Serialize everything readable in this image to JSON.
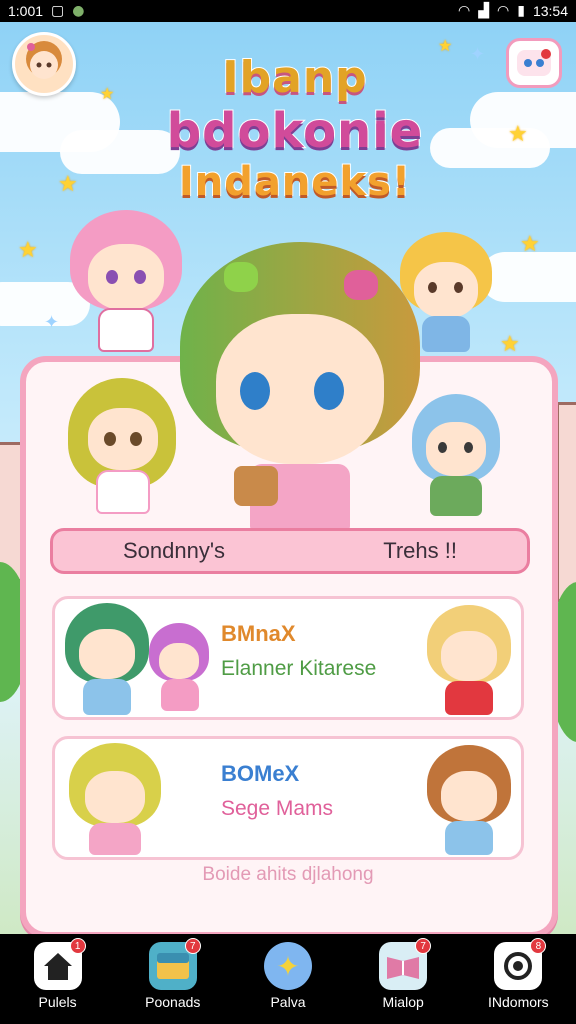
{
  "status_bar": {
    "time": "1:001",
    "clock": "13:54"
  },
  "logo": {
    "line1": "Ibanp",
    "line2": "bdokonie",
    "line3": "Indaneks!"
  },
  "banner": {
    "left_text": "Sondnny's",
    "right_text": "Trehs !!"
  },
  "cards": [
    {
      "title": "BMnaX",
      "subtitle": "Elanner Kitarese",
      "title_color": "#e0892c",
      "subtitle_color": "#4f9c45"
    },
    {
      "title": "BOMeX",
      "subtitle": "Sege Mams",
      "title_color": "#3a7fd1",
      "subtitle_color": "#e0609a"
    }
  ],
  "footer_note": "Boide ahits djlahong",
  "nav": [
    {
      "label": "Pulels",
      "icon": "home-icon",
      "badge": "1"
    },
    {
      "label": "Poonads",
      "icon": "chest-icon",
      "badge": "7"
    },
    {
      "label": "Palva",
      "icon": "star-bubble-icon",
      "badge": ""
    },
    {
      "label": "Mialop",
      "icon": "book-icon",
      "badge": "7"
    },
    {
      "label": "INdomors",
      "icon": "camera-icon",
      "badge": "8"
    }
  ],
  "colors": {
    "accent_pink": "#f4a5bf",
    "banner_pink": "#fbc4d4",
    "sky": "#8fd2f6"
  }
}
